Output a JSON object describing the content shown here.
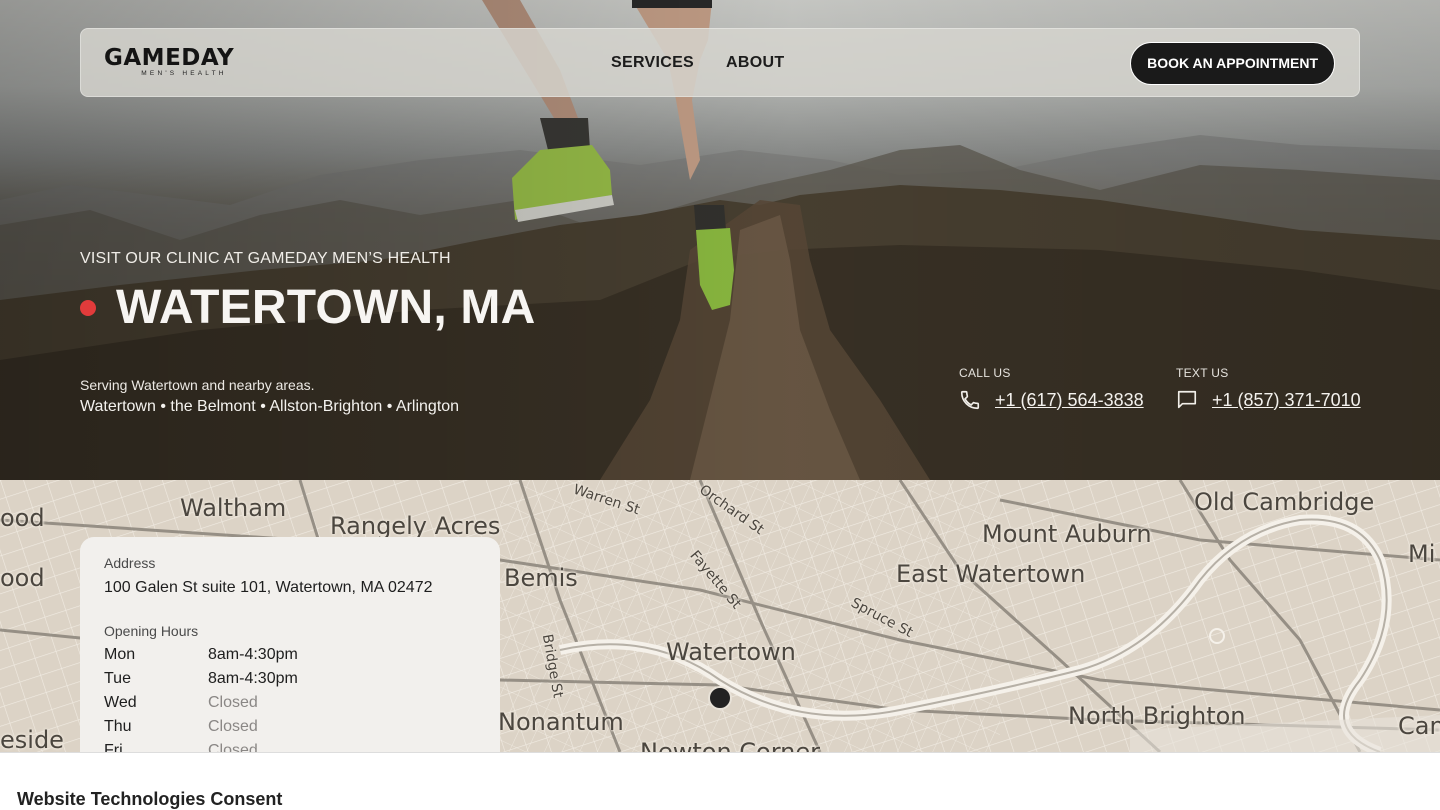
{
  "brand": {
    "name": "GAMEDAY",
    "tagline": "MEN'S HEALTH"
  },
  "nav": {
    "links": [
      "SERVICES",
      "ABOUT"
    ],
    "cta": "BOOK AN APPOINTMENT"
  },
  "hero": {
    "eyebrow": "VISIT OUR CLINIC AT GAMEDAY MEN’S HEALTH",
    "title": "WATERTOWN, MA",
    "serving": "Serving Watertown and nearby areas.",
    "areas": "Watertown • the Belmont • Allston-Brighton • Arlington",
    "accent_color": "#e23b3b"
  },
  "contact": {
    "call": {
      "label": "CALL US",
      "number": "+1 (617) 564-3838",
      "icon": "phone-icon"
    },
    "text": {
      "label": "TEXT US",
      "number": "+1 (857) 371-7010",
      "icon": "chat-icon"
    }
  },
  "map": {
    "labels": [
      "Waltham",
      "Rangely Acres",
      "Warren St",
      "Orchard St",
      "Old Cambridge",
      "Mount Auburn",
      "East Watertown",
      "Bemis",
      "Fayette St",
      "Spruce St",
      "Watertown",
      "Bridge St",
      "Nonantum",
      "North Brighton",
      "Newton Corner",
      "ood",
      "ood",
      "eside",
      "Mi",
      "Can"
    ]
  },
  "location_card": {
    "address_label": "Address",
    "address": "100 Galen St suite 101, Watertown, MA 02472",
    "hours_label": "Opening Hours",
    "hours": [
      {
        "day": "Mon",
        "value": "8am-4:30pm",
        "closed": false
      },
      {
        "day": "Tue",
        "value": "8am-4:30pm",
        "closed": false
      },
      {
        "day": "Wed",
        "value": "Closed",
        "closed": true
      },
      {
        "day": "Thu",
        "value": "Closed",
        "closed": true
      },
      {
        "day": "Fri",
        "value": "Closed",
        "closed": true
      }
    ]
  },
  "consent": {
    "title": "Website Technologies Consent"
  }
}
